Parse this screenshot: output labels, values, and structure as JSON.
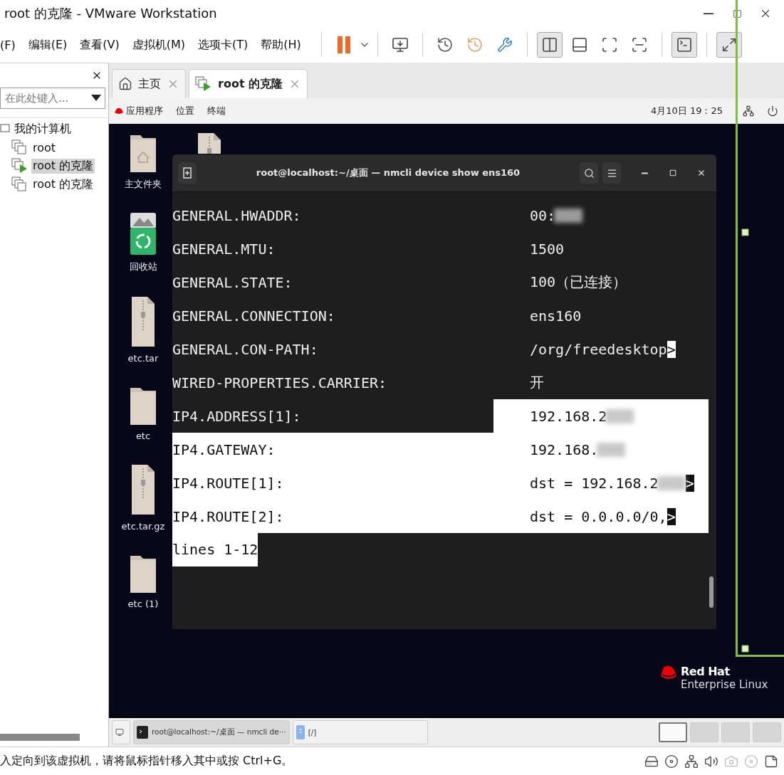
{
  "window": {
    "title": "root 的克隆 - VMware Workstation"
  },
  "menu": [
    "(F)",
    "编辑(E)",
    "查看(V)",
    "虚拟机(M)",
    "选项卡(T)",
    "帮助(H)"
  ],
  "library": {
    "search": {
      "placeholder": "在此处键入..."
    },
    "tree": [
      {
        "label": "我的计算机",
        "children": [
          {
            "label": "root",
            "selected": false,
            "running": false
          },
          {
            "label": "root 的克隆",
            "selected": true,
            "running": true
          },
          {
            "label": "root 的克隆",
            "selected": false,
            "running": false
          }
        ]
      }
    ]
  },
  "tabs": [
    {
      "label": "主页",
      "kind": "home",
      "selected": false
    },
    {
      "label": "root 的克隆",
      "kind": "vm",
      "selected": true
    }
  ],
  "guest": {
    "topbar": {
      "menus": [
        "应用程序",
        "位置",
        "终端"
      ],
      "clock": "4月10日 19：25"
    },
    "desktop_icons": [
      {
        "kind": "home-folder",
        "label": "主文件夹"
      },
      {
        "kind": "trash",
        "label": "回收站"
      },
      {
        "kind": "archive",
        "label": "etc.tar"
      },
      {
        "kind": "folder",
        "label": "etc"
      },
      {
        "kind": "archive",
        "label": "etc.tar.gz"
      },
      {
        "kind": "folder",
        "label": "etc (1)"
      }
    ],
    "terminal": {
      "title": "root@localhost:~/桌面 — nmcli device show ens160",
      "lines": [
        {
          "key": "GENERAL.HWADDR:",
          "value": "00:",
          "redacted": true,
          "key_selected": false,
          "value_selected": false
        },
        {
          "key": "GENERAL.MTU:",
          "value": "1500",
          "redacted": false,
          "key_selected": false,
          "value_selected": false
        },
        {
          "key": "GENERAL.STATE:",
          "value": "100（已连接）",
          "redacted": false,
          "key_selected": false,
          "value_selected": false
        },
        {
          "key": "GENERAL.CONNECTION:",
          "value": "ens160",
          "redacted": false,
          "key_selected": false,
          "value_selected": false
        },
        {
          "key": "GENERAL.CON-PATH:",
          "value": "/org/freedesktop",
          "marker": ">",
          "redacted": false,
          "key_selected": false,
          "value_selected": false
        },
        {
          "key": "WIRED-PROPERTIES.CARRIER:",
          "value": "开",
          "redacted": false,
          "key_selected": false,
          "value_selected": false
        },
        {
          "key": "IP4.ADDRESS[1]:",
          "value": "192.168.2",
          "redacted": true,
          "key_selected": false,
          "value_selected": true
        },
        {
          "key": "IP4.GATEWAY:",
          "value": "192.168.",
          "redacted": true,
          "key_selected": true,
          "value_selected": true
        },
        {
          "key": "IP4.ROUTE[1]:",
          "value": "dst = 192.168.2",
          "marker": ">",
          "redacted": true,
          "key_selected": true,
          "value_selected": true
        },
        {
          "key": "IP4.ROUTE[2]:",
          "value": "dst = 0.0.0.0/0,",
          "marker": ">",
          "redacted": false,
          "key_selected": true,
          "value_selected": true
        }
      ],
      "status": {
        "text": "lines 1-12",
        "selected": true
      }
    },
    "taskbar": {
      "tasks": [
        {
          "kind": "terminal",
          "label": "root@localhost:~/桌面 — nmcli de···",
          "selected": true
        },
        {
          "kind": "files",
          "label": "[/]",
          "selected": false
        }
      ],
      "workspaces": [
        {
          "selected": true
        },
        {
          "selected": false
        },
        {
          "selected": false
        },
        {
          "selected": false
        }
      ]
    },
    "logo": {
      "line1": "Red Hat",
      "line2": "Enterprise Linux"
    }
  },
  "status_bar": {
    "message": "入定向到该虚拟机，请将鼠标指针移入其中或按 Ctrl+G。"
  }
}
